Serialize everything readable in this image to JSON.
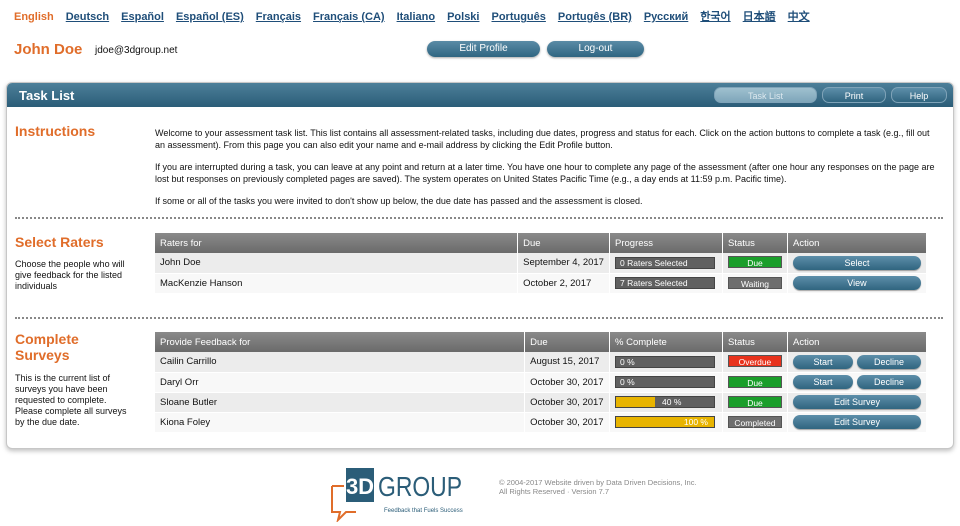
{
  "languages": [
    {
      "label": "English",
      "active": true
    },
    {
      "label": "Deutsch",
      "active": false
    },
    {
      "label": "Español",
      "active": false
    },
    {
      "label": "Español (ES)",
      "active": false
    },
    {
      "label": "Français",
      "active": false
    },
    {
      "label": "Français (CA)",
      "active": false
    },
    {
      "label": "Italiano",
      "active": false
    },
    {
      "label": "Polski",
      "active": false
    },
    {
      "label": "Português",
      "active": false
    },
    {
      "label": "Portugês (BR)",
      "active": false
    },
    {
      "label": "Русский",
      "active": false
    },
    {
      "label": "한국어",
      "active": false
    },
    {
      "label": "日本語",
      "active": false
    },
    {
      "label": "中文",
      "active": false
    }
  ],
  "user": {
    "name": "John Doe",
    "email": "jdoe@3dgroup.net"
  },
  "top_buttons": {
    "edit_profile": "Edit Profile",
    "logout": "Log-out"
  },
  "panel": {
    "title": "Task List",
    "buttons": {
      "task_list": "Task List",
      "print": "Print",
      "help": "Help"
    }
  },
  "instructions": {
    "title": "Instructions",
    "paragraphs": [
      "Welcome to your assessment task list. This list contains all assessment-related tasks, including due dates, progress and status for each. Click on the action buttons to complete a task (e.g., fill out an assessment). From this page you can also edit your name and e-mail address by clicking the Edit Profile button.",
      "If you are interrupted during a task, you can leave at any point and return at a later time. You have one hour to complete any page of the assessment (after one hour any responses on the page are lost but responses on previously completed pages are saved). The system operates on United States Pacific Time (e.g., a day ends at 11:59 p.m. Pacific time).",
      "If some or all of the tasks you were invited to don't show up below, the due date has passed and the assessment is closed."
    ]
  },
  "select_raters": {
    "title": "Select Raters",
    "description": "Choose the people who will give feedback for the listed individuals",
    "columns": [
      "Raters for",
      "Due",
      "Progress",
      "Status",
      "Action"
    ],
    "rows": [
      {
        "name": "John Doe",
        "due": "September 4, 2017",
        "progress": "0 Raters Selected",
        "status": "Due",
        "status_color": "#1a9e2a",
        "action": "Select"
      },
      {
        "name": "MacKenzie Hanson",
        "due": "October 2, 2017",
        "progress": "7 Raters Selected",
        "status": "Waiting",
        "status_color": "#6e6e6e",
        "action": "View"
      }
    ]
  },
  "complete_surveys": {
    "title": "Complete Surveys",
    "description": "This is the current list of surveys you have been requested to complete. Please complete all surveys by the due date.",
    "columns": [
      "Provide Feedback for",
      "Due",
      "% Complete",
      "Status",
      "Action"
    ],
    "rows": [
      {
        "name": "Cailin Carrillo",
        "due": "August 15, 2017",
        "percent": 0,
        "percent_label": "0 %",
        "status": "Overdue",
        "status_color": "#e8321c",
        "actions": [
          "Start",
          "Decline"
        ]
      },
      {
        "name": "Daryl Orr",
        "due": "October 30, 2017",
        "percent": 0,
        "percent_label": "0 %",
        "status": "Due",
        "status_color": "#1a9e2a",
        "actions": [
          "Start",
          "Decline"
        ]
      },
      {
        "name": "Sloane Butler",
        "due": "October 30, 2017",
        "percent": 40,
        "percent_label": "40 %",
        "status": "Due",
        "status_color": "#1a9e2a",
        "actions": [
          "Edit Survey"
        ]
      },
      {
        "name": "Kiona Foley",
        "due": "October 30, 2017",
        "percent": 100,
        "percent_label": "100 %",
        "status": "Completed",
        "status_color": "#6e6e6e",
        "actions": [
          "Edit Survey"
        ]
      }
    ]
  },
  "footer": {
    "logo_text": "3D GROUP",
    "logo_tagline": "Feedback that Fuels Success",
    "copyright": "© 2004-2017 Website driven by Data Driven Decisions, Inc.",
    "rights": "All Rights Reserved · Version 7.7"
  },
  "colors": {
    "accent": "#e06d2a",
    "brand_blue": "#2b5d78",
    "progress_fill": "#e8b400"
  }
}
